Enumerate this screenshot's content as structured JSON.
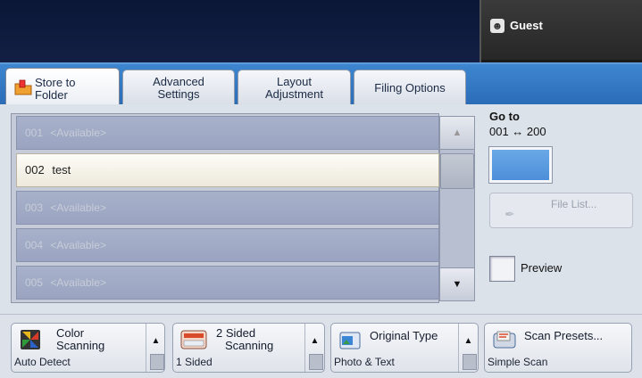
{
  "header": {
    "user_icon": "user-badge-icon",
    "user_name": "Guest"
  },
  "tabs": [
    {
      "label_line1": "Store to",
      "label_line2": "Folder",
      "active": true,
      "icon": "folder-store-icon"
    },
    {
      "label_line1": "Advanced",
      "label_line2": "Settings",
      "active": false
    },
    {
      "label_line1": "Layout",
      "label_line2": "Adjustment",
      "active": false
    },
    {
      "label_line1": "Filing Options",
      "label_line2": "",
      "active": false
    }
  ],
  "folder_list": {
    "rows": [
      {
        "number": "001",
        "name": "<Available>",
        "available": true
      },
      {
        "number": "002",
        "name": "test",
        "available": false
      },
      {
        "number": "003",
        "name": "<Available>",
        "available": true
      },
      {
        "number": "004",
        "name": "<Available>",
        "available": true
      },
      {
        "number": "005",
        "name": "<Available>",
        "available": true
      }
    ],
    "scroll_up": "▲",
    "scroll_down": "▼"
  },
  "goto": {
    "label": "Go to",
    "range": "001 ↔ 200",
    "value": ""
  },
  "file_list": {
    "label": "File List...",
    "icon": "file-list-icon",
    "enabled": false
  },
  "preview": {
    "label": "Preview",
    "checked": false
  },
  "bottom_controls": [
    {
      "title_line1": "Color",
      "title_line2": "Scanning",
      "value": "Auto Detect",
      "icon": "color-scanning-icon"
    },
    {
      "title_line1": "2 Sided",
      "title_line2": "Scanning",
      "value": "1 Sided",
      "icon": "two-sided-scanning-icon"
    },
    {
      "title_line1": "Original Type",
      "title_line2": "",
      "value": "Photo & Text",
      "icon": "original-type-icon"
    },
    {
      "title_line1": "Scan Presets...",
      "title_line2": "",
      "value": "Simple Scan",
      "icon": "scan-presets-icon"
    }
  ],
  "colors": {
    "header_bg": "#0b1736",
    "tab_strip": "#3a80cb",
    "list_row_empty": "#a3acc6",
    "list_row_selected": "#f8f6ee",
    "goto_field": "#5b9ce0"
  }
}
